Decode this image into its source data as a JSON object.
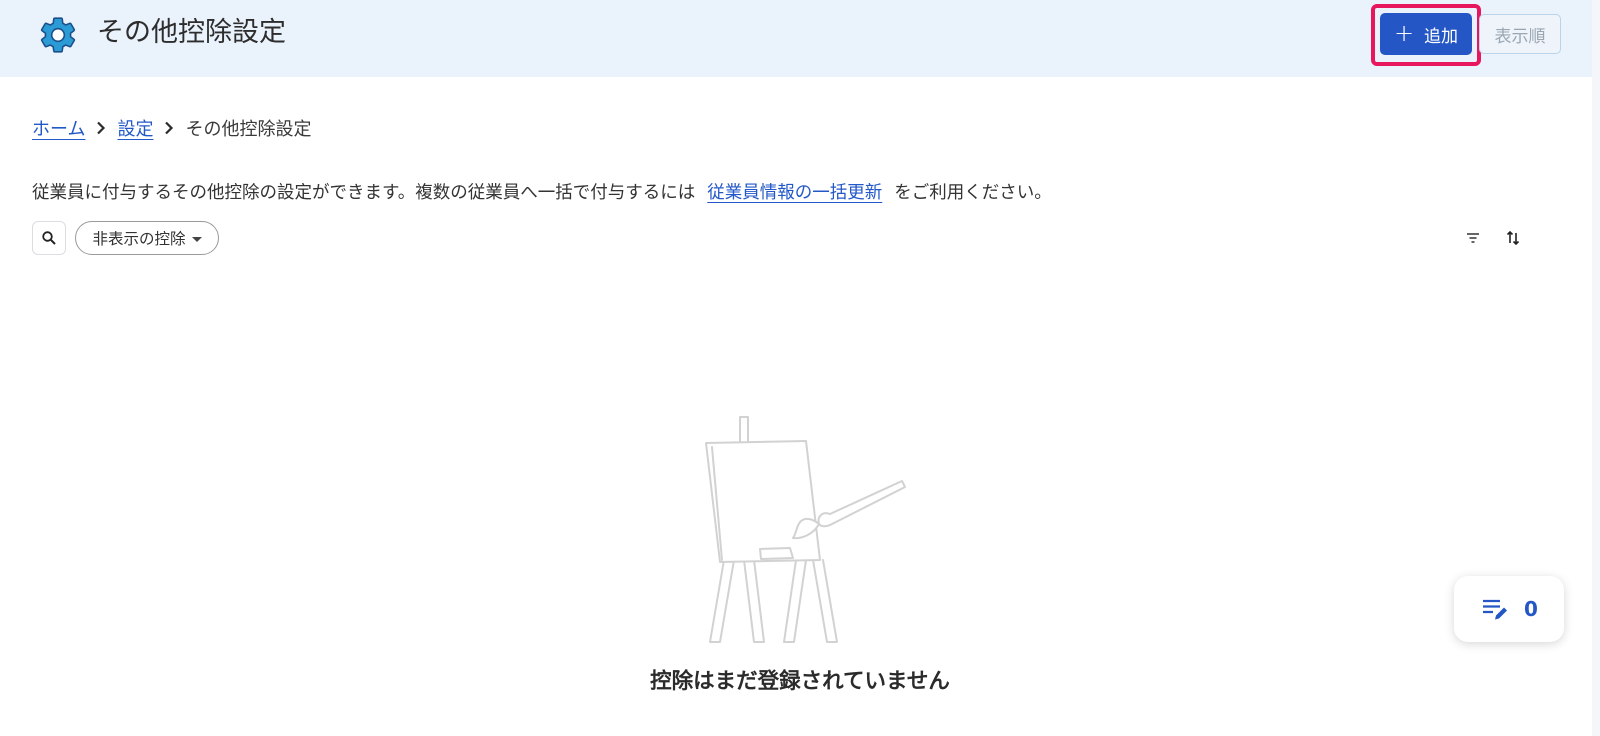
{
  "header": {
    "title": "その他控除設定",
    "title_icon": "gear-icon",
    "add_button_label": "追加",
    "order_button_label": "表示順",
    "accent_color": "#2457c5",
    "highlight_color": "#e8175d"
  },
  "breadcrumb": {
    "items": [
      {
        "label": "ホーム",
        "link": true
      },
      {
        "label": "設定",
        "link": true
      },
      {
        "label": "その他控除設定",
        "link": false
      }
    ]
  },
  "description": {
    "before": "従業員に付与するその他控除の設定ができます。複数の従業員へ一括で付与するには",
    "link": "従業員情報の一括更新",
    "after": "をご利用ください。"
  },
  "toolbar": {
    "search_icon": "search-icon",
    "filter_chip_label": "非表示の控除",
    "filter_icon": "filter-icon",
    "sort_icon": "sort-icon"
  },
  "empty_state": {
    "illustration": "easel-icon",
    "message": "控除はまだ登録されていません"
  },
  "fab": {
    "icon": "edit-list-icon",
    "count": "0"
  }
}
